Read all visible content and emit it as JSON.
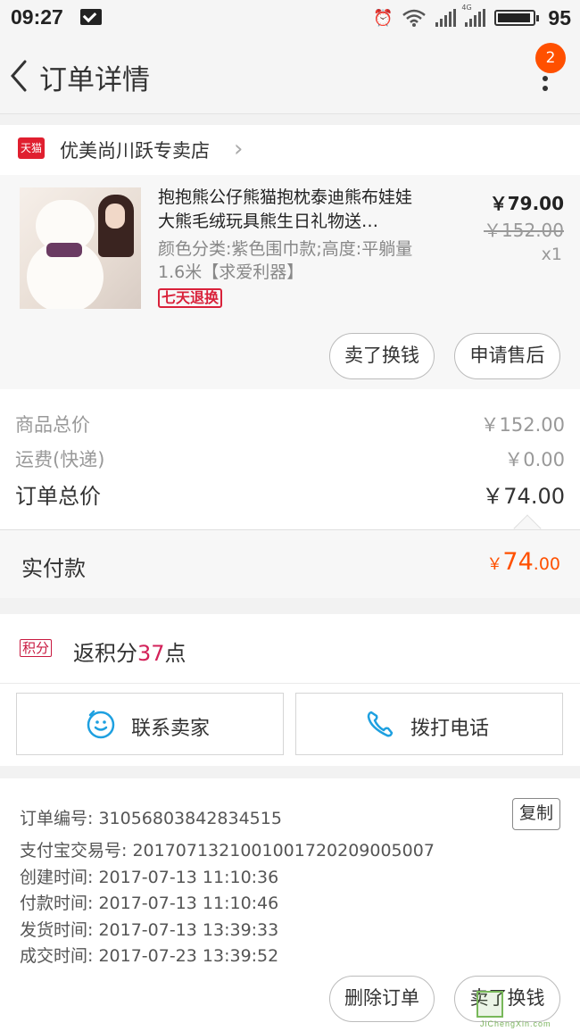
{
  "status_bar": {
    "time": "09:27",
    "battery": "95",
    "network": "4G"
  },
  "nav": {
    "title": "订单详情",
    "badge_count": "2"
  },
  "shop": {
    "badge": "天猫",
    "name": "优美尚川跃专卖店"
  },
  "product": {
    "title": "抱抱熊公仔熊猫抱枕泰迪熊布娃娃大熊毛绒玩具熊生日礼物送…",
    "spec": "颜色分类:紫色围巾款;高度:平躺量1.6米【求爱利器】",
    "return_tag": "七天退换",
    "price_now": "￥79.00",
    "price_old": "￥152.00",
    "qty": "x1",
    "btn_sell": "卖了换钱",
    "btn_aftersale": "申请售后"
  },
  "totals": {
    "goods_label": "商品总价",
    "goods_value": "￥152.00",
    "ship_label": "运费(快递)",
    "ship_value": "￥0.00",
    "order_label": "订单总价",
    "order_value": "￥74.00"
  },
  "paid": {
    "label": "实付款",
    "currency": "￥",
    "int": "74",
    "dec": ".00"
  },
  "points": {
    "tag": "积分",
    "prefix": "返积分",
    "num": "37",
    "suffix": "点"
  },
  "contact": {
    "seller": "联系卖家",
    "phone": "拨打电话"
  },
  "info": {
    "order_no": "订单编号: 31056803842834515",
    "copy": "复制",
    "alipay_no": "支付宝交易号: 2017071321001001720209005007",
    "created": "创建时间: 2017-07-13 11:10:36",
    "paid": "付款时间: 2017-07-13 11:10:46",
    "shipped": "发货时间: 2017-07-13 13:39:33",
    "closed": "成交时间: 2017-07-23 13:39:52"
  },
  "bottom": {
    "delete": "删除订单",
    "sell": "卖了换钱"
  },
  "watermark": {
    "text": "JiChengXin.com"
  },
  "colors": {
    "accent": "#ff5000",
    "tmall_red": "#e01f2f",
    "points_red": "#d3225a",
    "icon_blue": "#1ea0e0"
  }
}
